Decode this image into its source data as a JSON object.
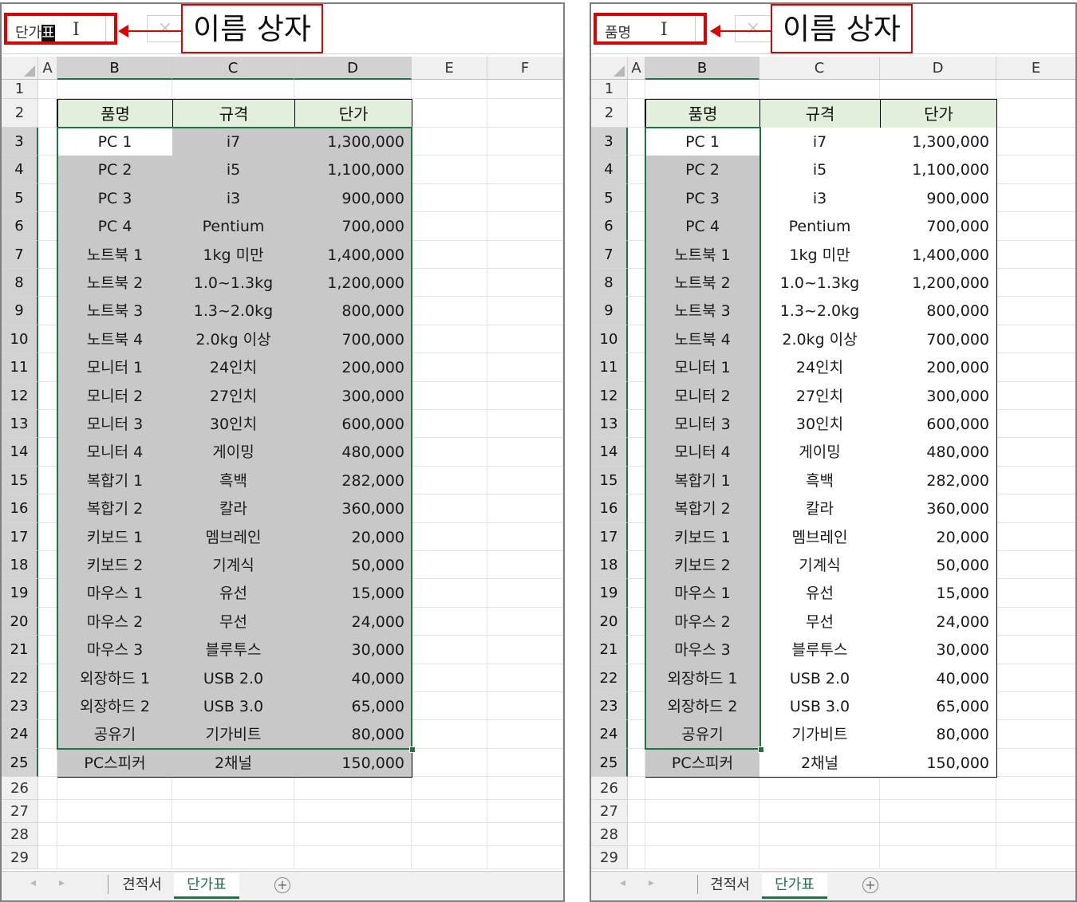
{
  "callout_label": "이름 상자",
  "name_box_icons": {
    "caret": "text-cursor-icon",
    "cancel": "close-x-icon"
  },
  "left": {
    "name_box": {
      "text": "단가",
      "highlighted": "표"
    },
    "columns": [
      "A",
      "B",
      "C",
      "D",
      "E",
      "F"
    ],
    "sheet_tabs": [
      "견적서",
      "단가표"
    ],
    "active_tab": "단가표"
  },
  "right": {
    "name_box": {
      "text": "품명"
    },
    "columns": [
      "A",
      "B",
      "C",
      "D",
      "E"
    ],
    "sheet_tabs": [
      "견적서",
      "단가표"
    ],
    "active_tab": "단가표"
  },
  "row_numbers": [
    "1",
    "2",
    "3",
    "4",
    "5",
    "6",
    "7",
    "8",
    "9",
    "10",
    "11",
    "12",
    "13",
    "14",
    "15",
    "16",
    "17",
    "18",
    "19",
    "20",
    "21",
    "22",
    "23",
    "24",
    "25",
    "26",
    "27",
    "28",
    "29"
  ],
  "table": {
    "headers": [
      "품명",
      "규격",
      "단가"
    ],
    "rows": [
      [
        "PC 1",
        "i7",
        "1,300,000"
      ],
      [
        "PC 2",
        "i5",
        "1,100,000"
      ],
      [
        "PC 3",
        "i3",
        "900,000"
      ],
      [
        "PC 4",
        "Pentium",
        "700,000"
      ],
      [
        "노트북 1",
        "1kg 미만",
        "1,400,000"
      ],
      [
        "노트북 2",
        "1.0~1.3kg",
        "1,200,000"
      ],
      [
        "노트북 3",
        "1.3~2.0kg",
        "800,000"
      ],
      [
        "노트북 4",
        "2.0kg 이상",
        "700,000"
      ],
      [
        "모니터 1",
        "24인치",
        "200,000"
      ],
      [
        "모니터 2",
        "27인치",
        "300,000"
      ],
      [
        "모니터 3",
        "30인치",
        "600,000"
      ],
      [
        "모니터 4",
        "게이밍",
        "480,000"
      ],
      [
        "복합기 1",
        "흑백",
        "282,000"
      ],
      [
        "복합기 2",
        "칼라",
        "360,000"
      ],
      [
        "키보드 1",
        "멤브레인",
        "20,000"
      ],
      [
        "키보드 2",
        "기계식",
        "50,000"
      ],
      [
        "마우스 1",
        "유선",
        "15,000"
      ],
      [
        "마우스 2",
        "무선",
        "24,000"
      ],
      [
        "마우스 3",
        "블루투스",
        "30,000"
      ],
      [
        "외장하드 1",
        "USB 2.0",
        "40,000"
      ],
      [
        "외장하드 2",
        "USB 3.0",
        "65,000"
      ],
      [
        "공유기",
        "기가비트",
        "80,000"
      ],
      [
        "PC스피커",
        "2채널",
        "150,000"
      ]
    ]
  },
  "colors": {
    "accent": "#217346",
    "header_fill": "#e2efda",
    "selection_fill": "#c8c8c8",
    "callout_border": "#e00000"
  }
}
